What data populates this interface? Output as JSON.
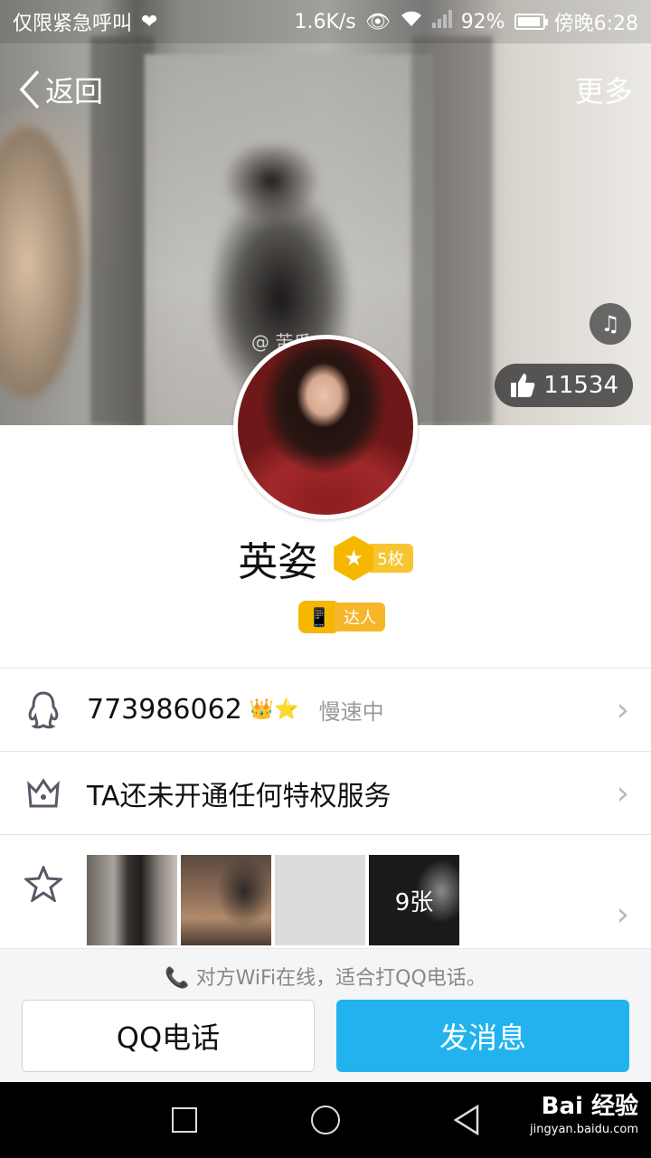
{
  "status_bar": {
    "carrier": "仅限紧急呼叫",
    "speed": "1.6K/s",
    "battery": "92%",
    "time": "傍晚6:28"
  },
  "nav": {
    "back_label": "返回",
    "more_label": "更多"
  },
  "cover": {
    "watermark": "@ 苦瓜",
    "likes": "11534"
  },
  "profile": {
    "name": "英姿",
    "medal_count": "5枚",
    "talent_tag": "达人"
  },
  "rows": {
    "qq_number": "773986062",
    "qq_status": "慢速中",
    "privilege": "TA还未开通任何特权服务",
    "photo_count": "9张"
  },
  "bottom": {
    "wifi_tip": "对方WiFi在线，适合打QQ电话。",
    "call_label": "QQ电话",
    "message_label": "发消息"
  },
  "watermark_brand": {
    "name": "Bai 经验",
    "url": "jingyan.baidu.com"
  }
}
